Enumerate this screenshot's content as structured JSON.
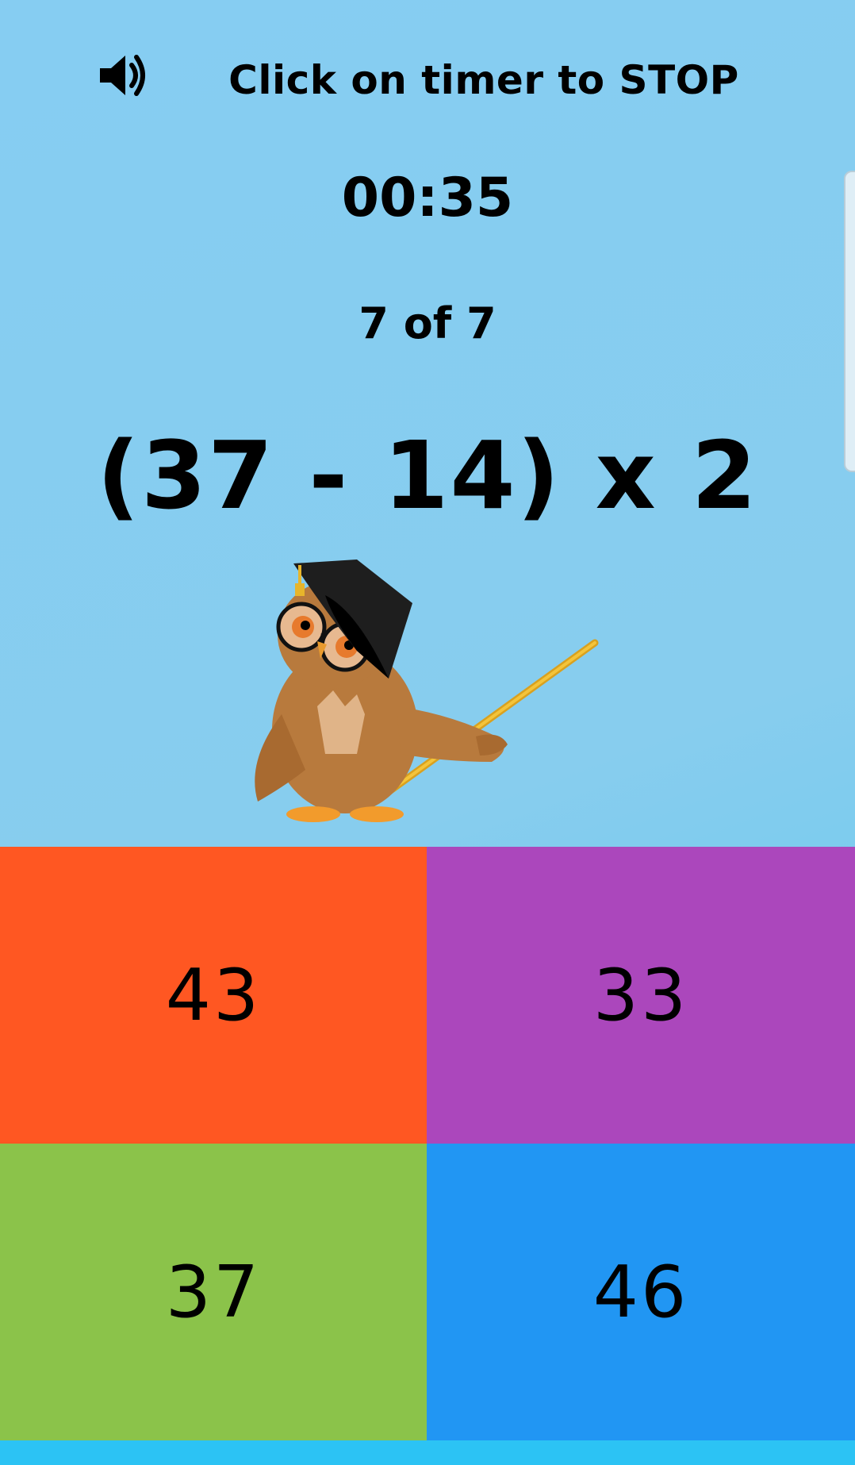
{
  "header": {
    "sound_icon": "speaker-volume-icon",
    "instruction": "Click on timer to STOP"
  },
  "timer": "00:35",
  "progress": "7 of 7",
  "question": "(37 - 14) x 2",
  "illustration": "owl-teacher-with-graduation-cap-and-pointer",
  "answers": [
    {
      "label": "43",
      "color": "#ff5722"
    },
    {
      "label": "33",
      "color": "#ab47bc"
    },
    {
      "label": "37",
      "color": "#8bc34a"
    },
    {
      "label": "46",
      "color": "#2196f3"
    }
  ],
  "colors": {
    "background": "#87cdee",
    "bottom_strip": "#2cc3f4",
    "text": "#000000"
  }
}
